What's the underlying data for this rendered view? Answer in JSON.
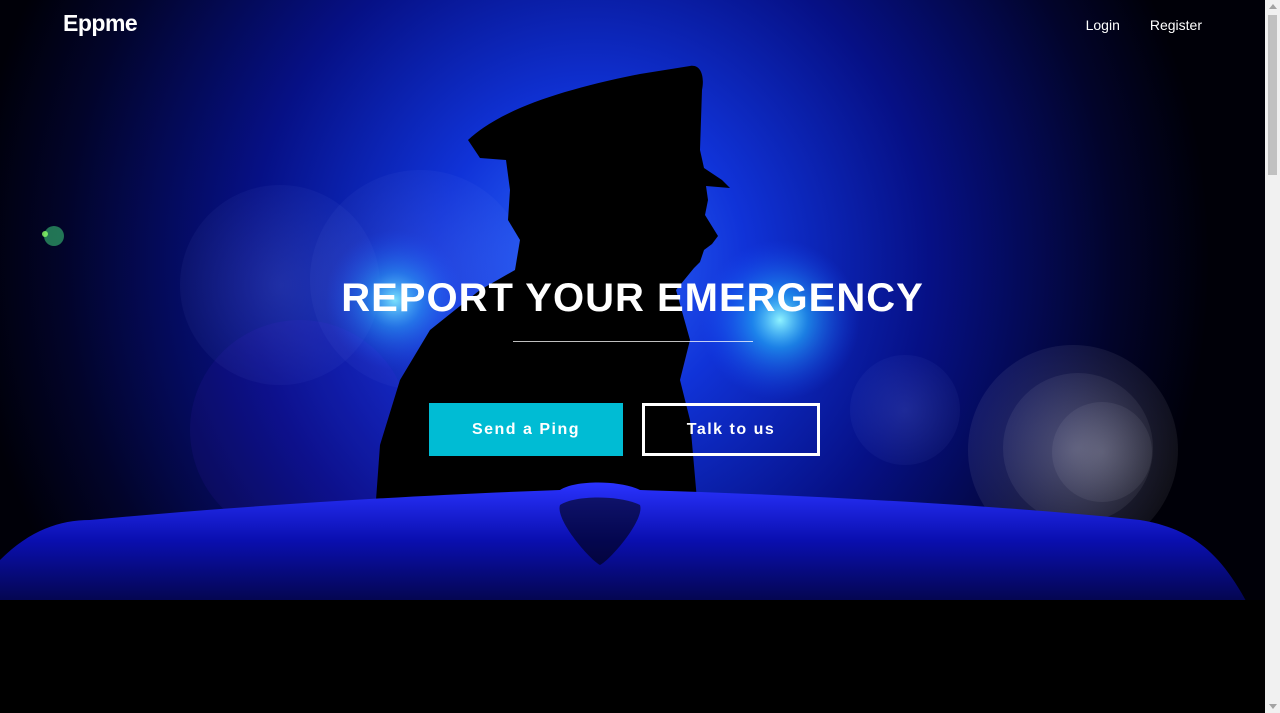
{
  "nav": {
    "brand": "Eppme",
    "links": [
      {
        "label": "Login"
      },
      {
        "label": "Register"
      }
    ]
  },
  "hero": {
    "title": "REPORT YOUR EMERGENCY",
    "primary_button": "Send a Ping",
    "secondary_button": "Talk to us"
  },
  "colors": {
    "accent": "#00bcd4",
    "background": "#000000",
    "glow": "#1a4dff"
  }
}
